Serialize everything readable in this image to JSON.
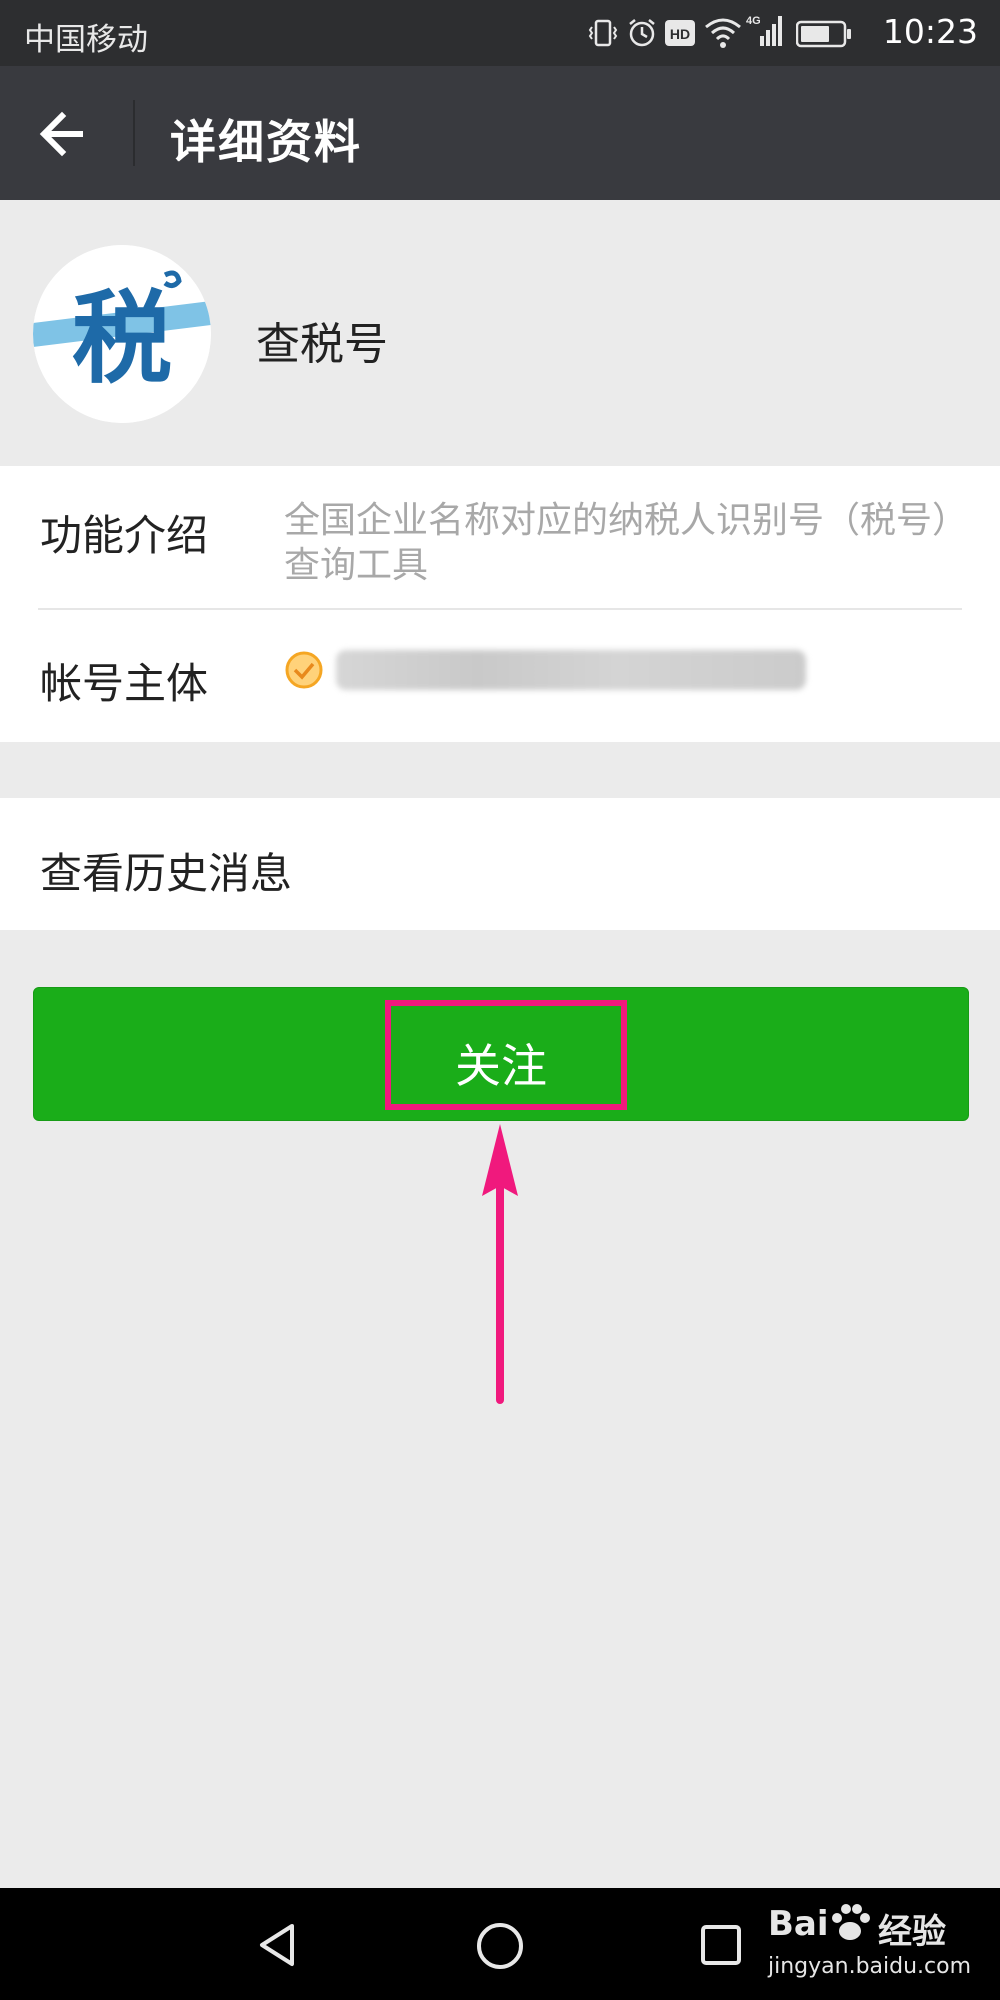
{
  "status_bar": {
    "carrier": "中国移动",
    "time": "10:23",
    "network": "4G",
    "hd_label": "HD",
    "icons": [
      "vibrate-icon",
      "alarm-icon",
      "hd-icon",
      "wifi-icon",
      "signal-icon",
      "battery-icon"
    ]
  },
  "app_bar": {
    "title": "详细资料",
    "back_icon": "back-arrow-icon"
  },
  "profile": {
    "name": "查税号",
    "avatar_glyph": "税"
  },
  "info": {
    "intro_label": "功能介绍",
    "intro_value": "全国企业名称对应的纳税人识别号（税号）查询工具",
    "owner_label": "帐号主体"
  },
  "history": {
    "label": "查看历史消息"
  },
  "follow_button": {
    "label": "关注"
  },
  "nav_bar": {
    "icons": [
      "back-triangle-icon",
      "home-circle-icon",
      "recents-square-icon"
    ]
  },
  "watermark": {
    "brand": "Bai",
    "brand_suffix": "经验",
    "url": "jingyan.baidu.com"
  },
  "colors": {
    "accent_green": "#1aad19",
    "annotation_pink": "#f0197d",
    "app_bar": "#393a3f",
    "status_bar": "#2d2e30"
  }
}
